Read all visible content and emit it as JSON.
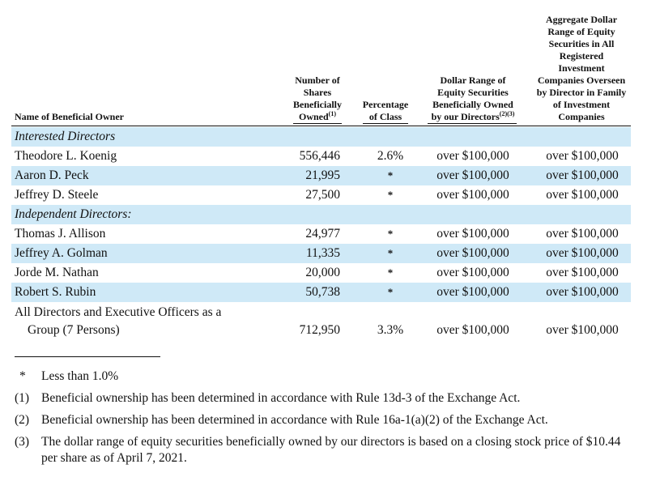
{
  "headers": {
    "name": "Name of Beneficial Owner",
    "shares_line1": "Number of",
    "shares_line2": "Shares",
    "shares_line3": "Beneficially",
    "shares_line4": "Owned",
    "shares_sup": "(1)",
    "pct_line1": "Percentage",
    "pct_line2": "of Class",
    "dollar_line1": "Dollar Range of",
    "dollar_line2": "Equity Securities",
    "dollar_line3": "Beneficially Owned",
    "dollar_line4": "by our Directors",
    "dollar_sup": "(2)(3)",
    "agg_line1": "Aggregate Dollar",
    "agg_line2": "Range of Equity",
    "agg_line3": "Securities in All",
    "agg_line4": "Registered",
    "agg_line5": "Investment",
    "agg_line6": "Companies Overseen",
    "agg_line7": "by Director in Family",
    "agg_line8": "of Investment",
    "agg_line9": "Companies"
  },
  "sections": {
    "interested": "Interested Directors",
    "independent": "Independent Directors:"
  },
  "rows": [
    {
      "name": "Theodore L. Koenig",
      "shares": "556,446",
      "pct": "2.6%",
      "dollar": "over $100,000",
      "agg": "over $100,000"
    },
    {
      "name": "Aaron D. Peck",
      "shares": "21,995",
      "pct": "*",
      "dollar": "over $100,000",
      "agg": "over $100,000"
    },
    {
      "name": "Jeffrey D. Steele",
      "shares": "27,500",
      "pct": "*",
      "dollar": "over $100,000",
      "agg": "over $100,000"
    },
    {
      "name": "Thomas J. Allison",
      "shares": "24,977",
      "pct": "*",
      "dollar": "over $100,000",
      "agg": "over $100,000"
    },
    {
      "name": "Jeffrey A. Golman",
      "shares": "11,335",
      "pct": "*",
      "dollar": "over $100,000",
      "agg": "over $100,000"
    },
    {
      "name": "Jorde M. Nathan",
      "shares": "20,000",
      "pct": "*",
      "dollar": "over $100,000",
      "agg": "over $100,000"
    },
    {
      "name": "Robert S. Rubin",
      "shares": "50,738",
      "pct": "*",
      "dollar": "over $100,000",
      "agg": "over $100,000"
    }
  ],
  "group": {
    "name_line1": "All Directors and Executive Officers as a",
    "name_line2": "Group (7 Persons)",
    "shares": "712,950",
    "pct": "3.3%",
    "dollar": "over $100,000",
    "agg": "over $100,000"
  },
  "footnotes": [
    {
      "mark": "*",
      "text": "Less than 1.0%"
    },
    {
      "mark": "(1)",
      "text": "Beneficial ownership has been determined in accordance with Rule 13d-3 of the Exchange Act."
    },
    {
      "mark": "(2)",
      "text": "Beneficial ownership has been determined in accordance with Rule 16a-1(a)(2) of the Exchange Act."
    },
    {
      "mark": "(3)",
      "text": "The dollar range of equity securities beneficially owned by our directors is based on a closing stock price of $10.44 per share as of April 7, 2021."
    }
  ],
  "colors": {
    "row_shade": "#cfe9f7",
    "text": "#111111"
  }
}
